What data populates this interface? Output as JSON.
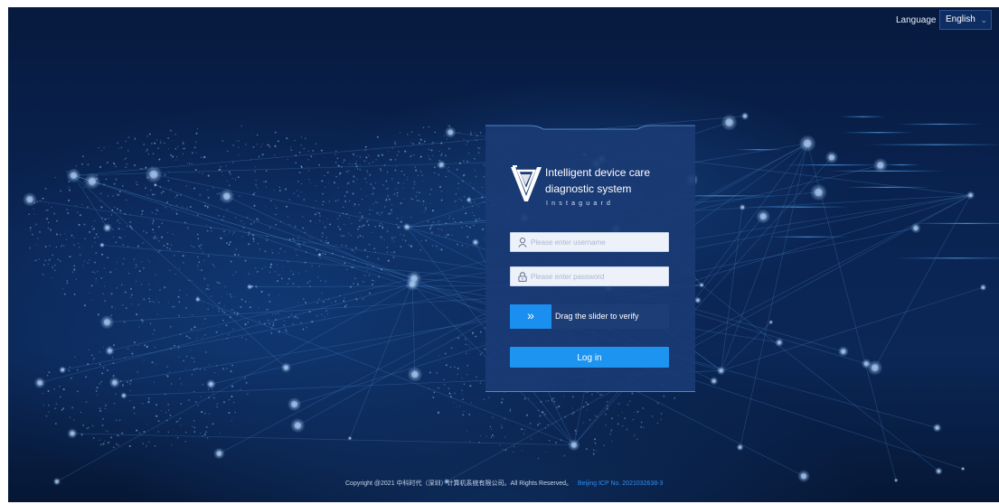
{
  "header": {
    "language_label": "Language",
    "language_selected": "English"
  },
  "login": {
    "brand_line1": "Intelligent device care",
    "brand_line2": "diagnostic system",
    "brand_sub": "Instaguard",
    "username_placeholder": "Please enter username",
    "password_placeholder": "Please enter password",
    "slider_text": "Drag the slider to verify",
    "login_label": "Log in"
  },
  "footer": {
    "copyright": "Copyright @2021 中科时代（深圳）计算机系统有限公司。All Rights Reserved。",
    "icp": "Beijing ICP No. 2021032638-3"
  },
  "colors": {
    "background": "#0a2452",
    "card": "#1a3a74",
    "accent": "#1d94ef",
    "link": "#2d8df0"
  },
  "icons": {
    "user": "user-icon",
    "lock": "lock-icon",
    "slider": "double-chevron-right-icon",
    "dropdown": "chevron-down-icon",
    "logo": "instaguard-logo"
  }
}
